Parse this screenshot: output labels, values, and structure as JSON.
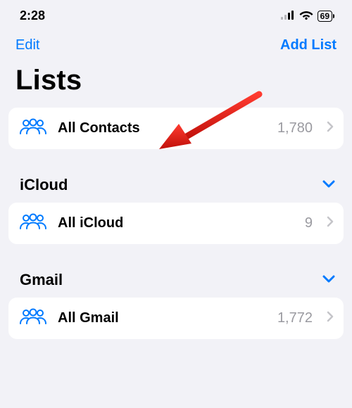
{
  "status": {
    "time": "2:28",
    "battery": "69"
  },
  "nav": {
    "edit": "Edit",
    "add_list": "Add List"
  },
  "title": "Lists",
  "all_contacts": {
    "label": "All Contacts",
    "count": "1,780"
  },
  "sections": [
    {
      "name": "iCloud",
      "rows": [
        {
          "label": "All iCloud",
          "count": "9"
        }
      ]
    },
    {
      "name": "Gmail",
      "rows": [
        {
          "label": "All Gmail",
          "count": "1,772"
        }
      ]
    }
  ]
}
